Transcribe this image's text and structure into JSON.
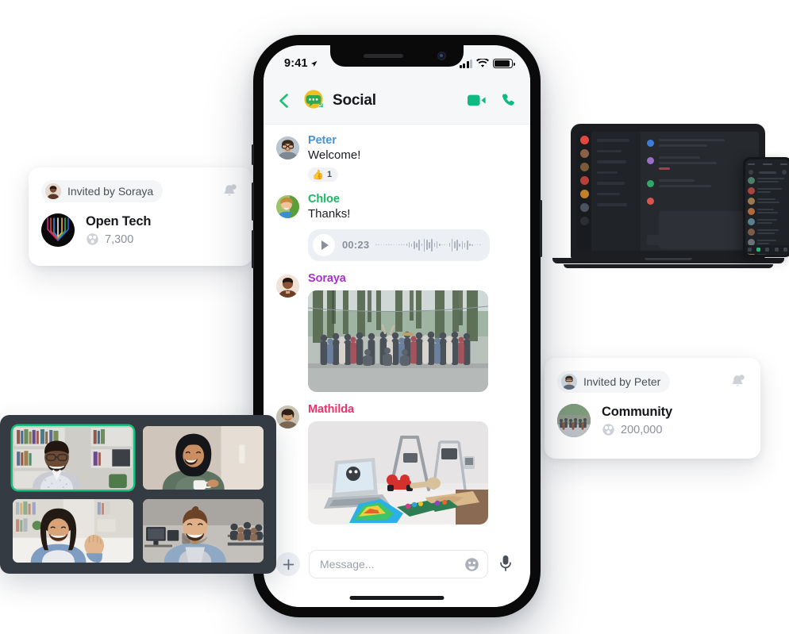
{
  "app": {
    "title": "Social",
    "logo_icon": "chat-bubble-logo",
    "verified_icon": "verified-badge-icon"
  },
  "phone": {
    "status_bar": {
      "time": "9:41",
      "location_icon": "location-arrow-icon",
      "signal_icon": "cellular-signal-icon",
      "wifi_icon": "wifi-icon",
      "battery_icon": "battery-icon"
    },
    "header": {
      "back_icon": "back-chevron-icon",
      "title": "Social",
      "video_call_icon": "video-camera-icon",
      "voice_call_icon": "phone-handset-icon"
    },
    "messages": [
      {
        "sender": "Peter",
        "sender_color": "#4a92d6",
        "avatar_icon": "avatar-peter",
        "text": "Welcome!",
        "reaction": {
          "emoji": "👍",
          "count": "1"
        }
      },
      {
        "sender": "Chloe",
        "sender_color": "#1ab863",
        "avatar_icon": "avatar-chloe",
        "text": "Thanks!",
        "voice_note": {
          "duration": "00:23",
          "play_icon": "play-icon",
          "waveform_icon": "audio-waveform"
        }
      },
      {
        "sender": "Soraya",
        "sender_color": "#a832c9",
        "avatar_icon": "avatar-soraya",
        "photo_icon": "photo-group-outdoors"
      },
      {
        "sender": "Mathilda",
        "sender_color": "#e8346b",
        "avatar_icon": "avatar-mathilda",
        "photo_icon": "photo-3d-printer-desk"
      }
    ],
    "composer": {
      "add_icon": "plus-icon",
      "placeholder": "Message...",
      "value": "",
      "emoji_icon": "smiley-face-icon",
      "mic_icon": "microphone-icon"
    },
    "home_indicator": "home-indicator"
  },
  "cards": [
    {
      "id": "open-tech",
      "invited_by": "Invited by Soraya",
      "inviter_avatar_icon": "avatar-soraya",
      "bell_icon": "bell-notification-icon",
      "group_avatar_icon": "open-tech-logo",
      "group_name": "Open Tech",
      "members_icon": "members-globe-icon",
      "members_count": "7,300"
    },
    {
      "id": "community",
      "invited_by": "Invited by Peter",
      "inviter_avatar_icon": "avatar-peter",
      "bell_icon": "bell-notification-icon",
      "group_avatar_icon": "community-group-photo",
      "group_name": "Community",
      "members_icon": "members-globe-icon",
      "members_count": "200,000"
    }
  ],
  "laptop": {
    "device_icon": "laptop-device",
    "app_preview_icon": "dark-chat-app-preview",
    "mini_phone_icon": "mini-phone-contacts-list"
  },
  "video_call": {
    "container_icon": "video-call-grid",
    "tiles": [
      {
        "id": "tile-1",
        "participant_icon": "participant-man-bookshelf",
        "active": true
      },
      {
        "id": "tile-2",
        "participant_icon": "participant-woman-hijab-coffee",
        "active": false
      },
      {
        "id": "tile-3",
        "participant_icon": "participant-woman-waving",
        "active": false
      },
      {
        "id": "tile-4",
        "participant_icon": "participant-man-office",
        "active": false
      }
    ],
    "active_border_color": "#0ec47c"
  },
  "colors": {
    "background": "#ffffff",
    "accent_green": "#1fbf75",
    "phone_frame": "#0a0a0a",
    "chat_header_bg": "#f6f7f9",
    "video_grid_bg": "#353b43"
  }
}
